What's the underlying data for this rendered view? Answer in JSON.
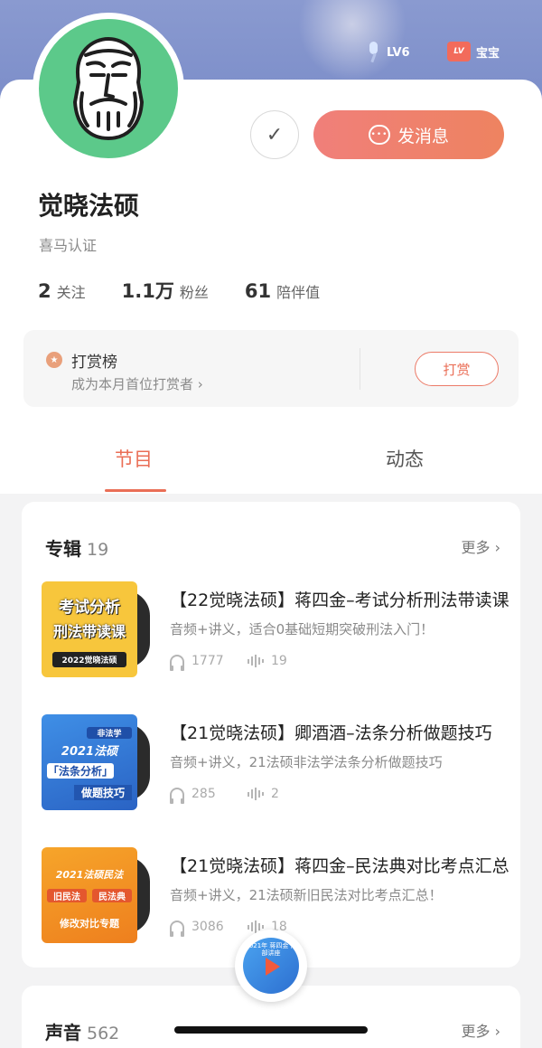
{
  "header": {
    "level_label": "LV6",
    "tag_icon_text": "LV",
    "tag_label": "宝宝"
  },
  "profile": {
    "name": "觉晓法硕",
    "verification": "喜马认证",
    "follow_icon": "check-icon",
    "message_label": "发消息",
    "stats": [
      {
        "value": "2",
        "label": "关注"
      },
      {
        "value": "1.1万",
        "label": "粉丝"
      },
      {
        "value": "61",
        "label": "陪伴值"
      }
    ]
  },
  "reward": {
    "title": "打赏榜",
    "subtitle": "成为本月首位打赏者 ›",
    "button": "打赏"
  },
  "tabs": {
    "programs": "节目",
    "dynamics": "动态"
  },
  "albums": {
    "title": "专辑",
    "count": "19",
    "more": "更多 ›",
    "items": [
      {
        "cover_line1": "考试分析",
        "cover_line2": "刑法带读课",
        "cover_line3": "2022觉晓法硕",
        "title": "【22觉晓法硕】蒋四金–考试分析刑法带读课",
        "desc": "音频+讲义，适合0基础短期突破刑法入门！",
        "plays": "1777",
        "tracks": "19"
      },
      {
        "cover_line1": "非法学",
        "cover_line2": "2021法硕",
        "cover_line3": "「法条分析」",
        "cover_line4": "做题技巧",
        "title": "【21觉晓法硕】卿酒酒–法条分析做题技巧",
        "desc": "音频+讲义，21法硕非法学法条分析做题技巧",
        "plays": "285",
        "tracks": "2"
      },
      {
        "cover_line1": "2021法硕民法",
        "cover_line2": "旧民法",
        "cover_line3": "民法典",
        "cover_line4": "修改对比专题",
        "title": "【21觉晓法硕】蒋四金–民法典对比考点汇总",
        "desc": "音频+讲义，21法硕新旧民法对比考点汇总！",
        "plays": "3086",
        "tracks": "18"
      }
    ]
  },
  "voices": {
    "title": "声音",
    "count": "562",
    "more": "更多 ›"
  },
  "player": {
    "cover_text": "2021年 蒋四金 内部讲座"
  }
}
